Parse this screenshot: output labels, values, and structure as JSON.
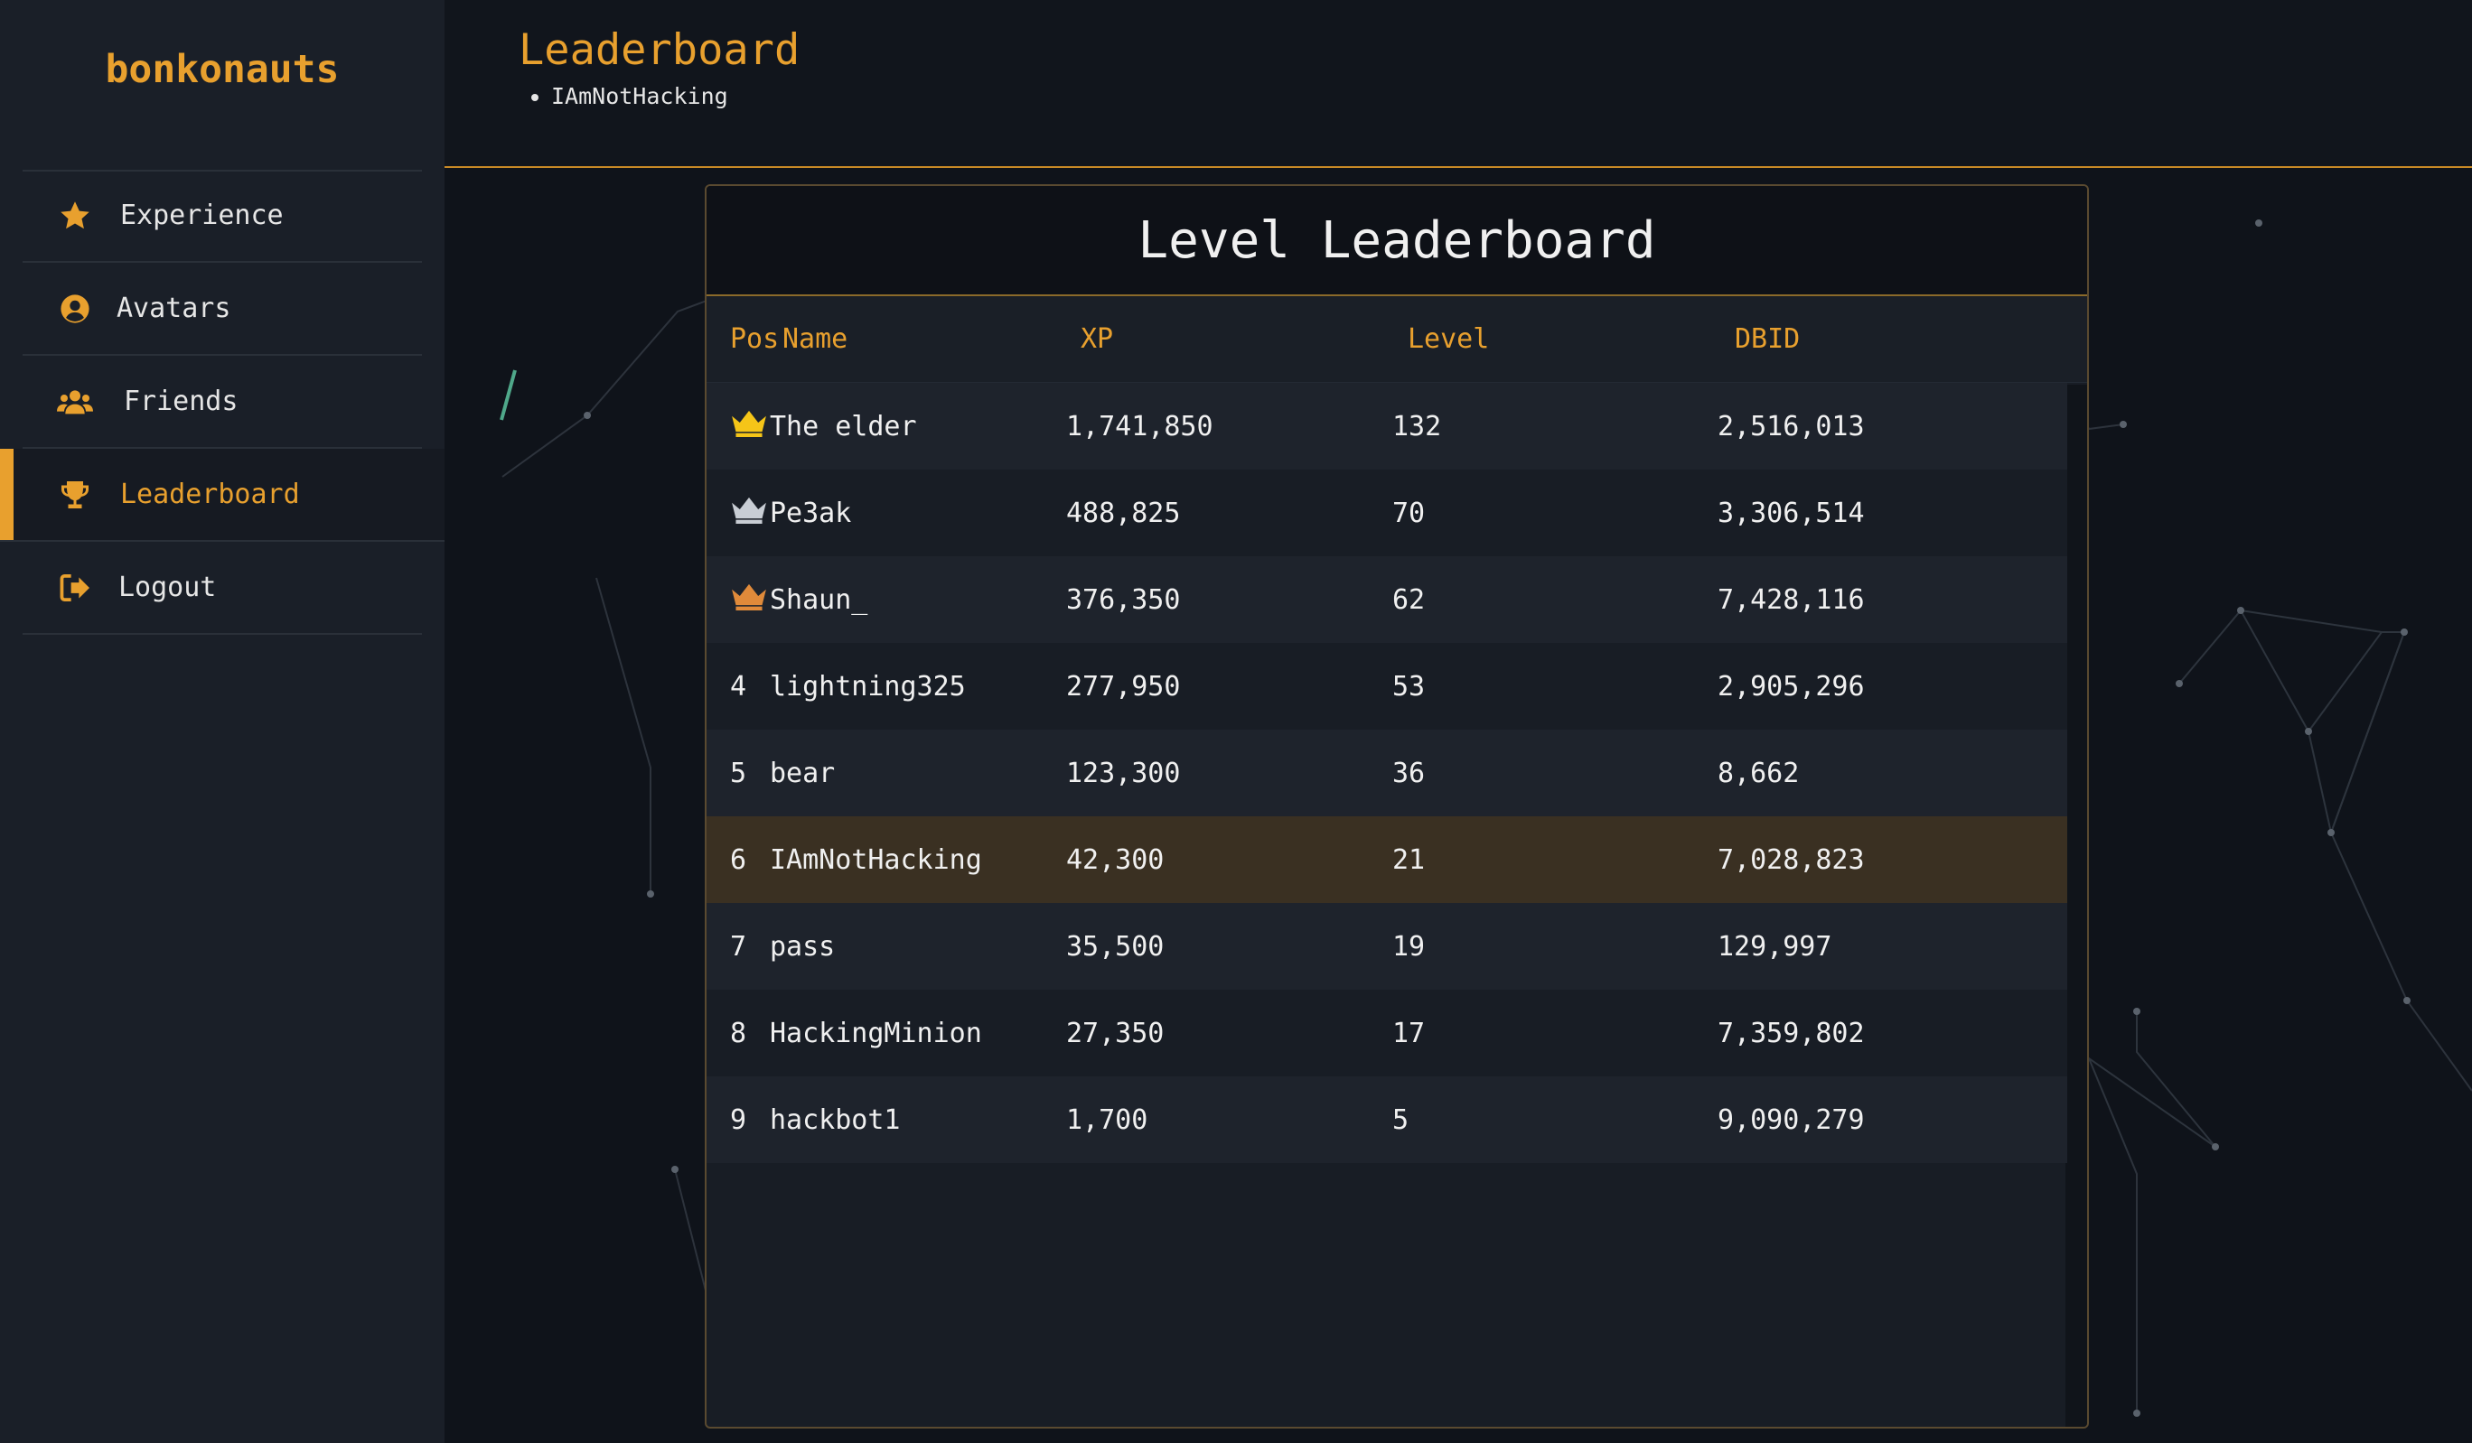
{
  "app": {
    "brand": "bonkonauts"
  },
  "colors": {
    "accent": "#e8a02e",
    "gold": "#f5c518",
    "silver": "#c8cdd4",
    "bronze": "#e08a3a",
    "highlight_row": "#3a3022"
  },
  "sidebar": {
    "items": [
      {
        "label": "Experience",
        "icon": "star-icon",
        "active": false
      },
      {
        "label": "Avatars",
        "icon": "user-circle-icon",
        "active": false
      },
      {
        "label": "Friends",
        "icon": "users-icon",
        "active": false
      },
      {
        "label": "Leaderboard",
        "icon": "trophy-icon",
        "active": true
      },
      {
        "label": "Logout",
        "icon": "logout-icon",
        "active": false
      }
    ]
  },
  "header": {
    "title": "Leaderboard",
    "users": [
      "IAmNotHacking"
    ]
  },
  "leaderboard": {
    "title": "Level Leaderboard",
    "columns": {
      "pos": "Pos",
      "name": "Name",
      "xp": "XP",
      "level": "Level",
      "dbid": "DBID"
    },
    "rows": [
      {
        "pos": "",
        "medal": "gold-crown-icon",
        "name": "The elder",
        "xp": "1,741,850",
        "level": "132",
        "dbid": "2,516,013"
      },
      {
        "pos": "",
        "medal": "silver-crown-icon",
        "name": "Pe3ak",
        "xp": "488,825",
        "level": "70",
        "dbid": "3,306,514"
      },
      {
        "pos": "",
        "medal": "bronze-crown-icon",
        "name": "Shaun_",
        "xp": "376,350",
        "level": "62",
        "dbid": "7,428,116"
      },
      {
        "pos": "4",
        "name": "lightning325",
        "xp": "277,950",
        "level": "53",
        "dbid": "2,905,296"
      },
      {
        "pos": "5",
        "name": "bear",
        "xp": "123,300",
        "level": "36",
        "dbid": "8,662"
      },
      {
        "pos": "6",
        "name": "IAmNotHacking",
        "xp": "42,300",
        "level": "21",
        "dbid": "7,028,823",
        "current_user": true
      },
      {
        "pos": "7",
        "name": "pass",
        "xp": "35,500",
        "level": "19",
        "dbid": "129,997"
      },
      {
        "pos": "8",
        "name": "HackingMinion",
        "xp": "27,350",
        "level": "17",
        "dbid": "7,359,802"
      },
      {
        "pos": "9",
        "name": "hackbot1",
        "xp": "1,700",
        "level": "5",
        "dbid": "9,090,279"
      }
    ]
  }
}
